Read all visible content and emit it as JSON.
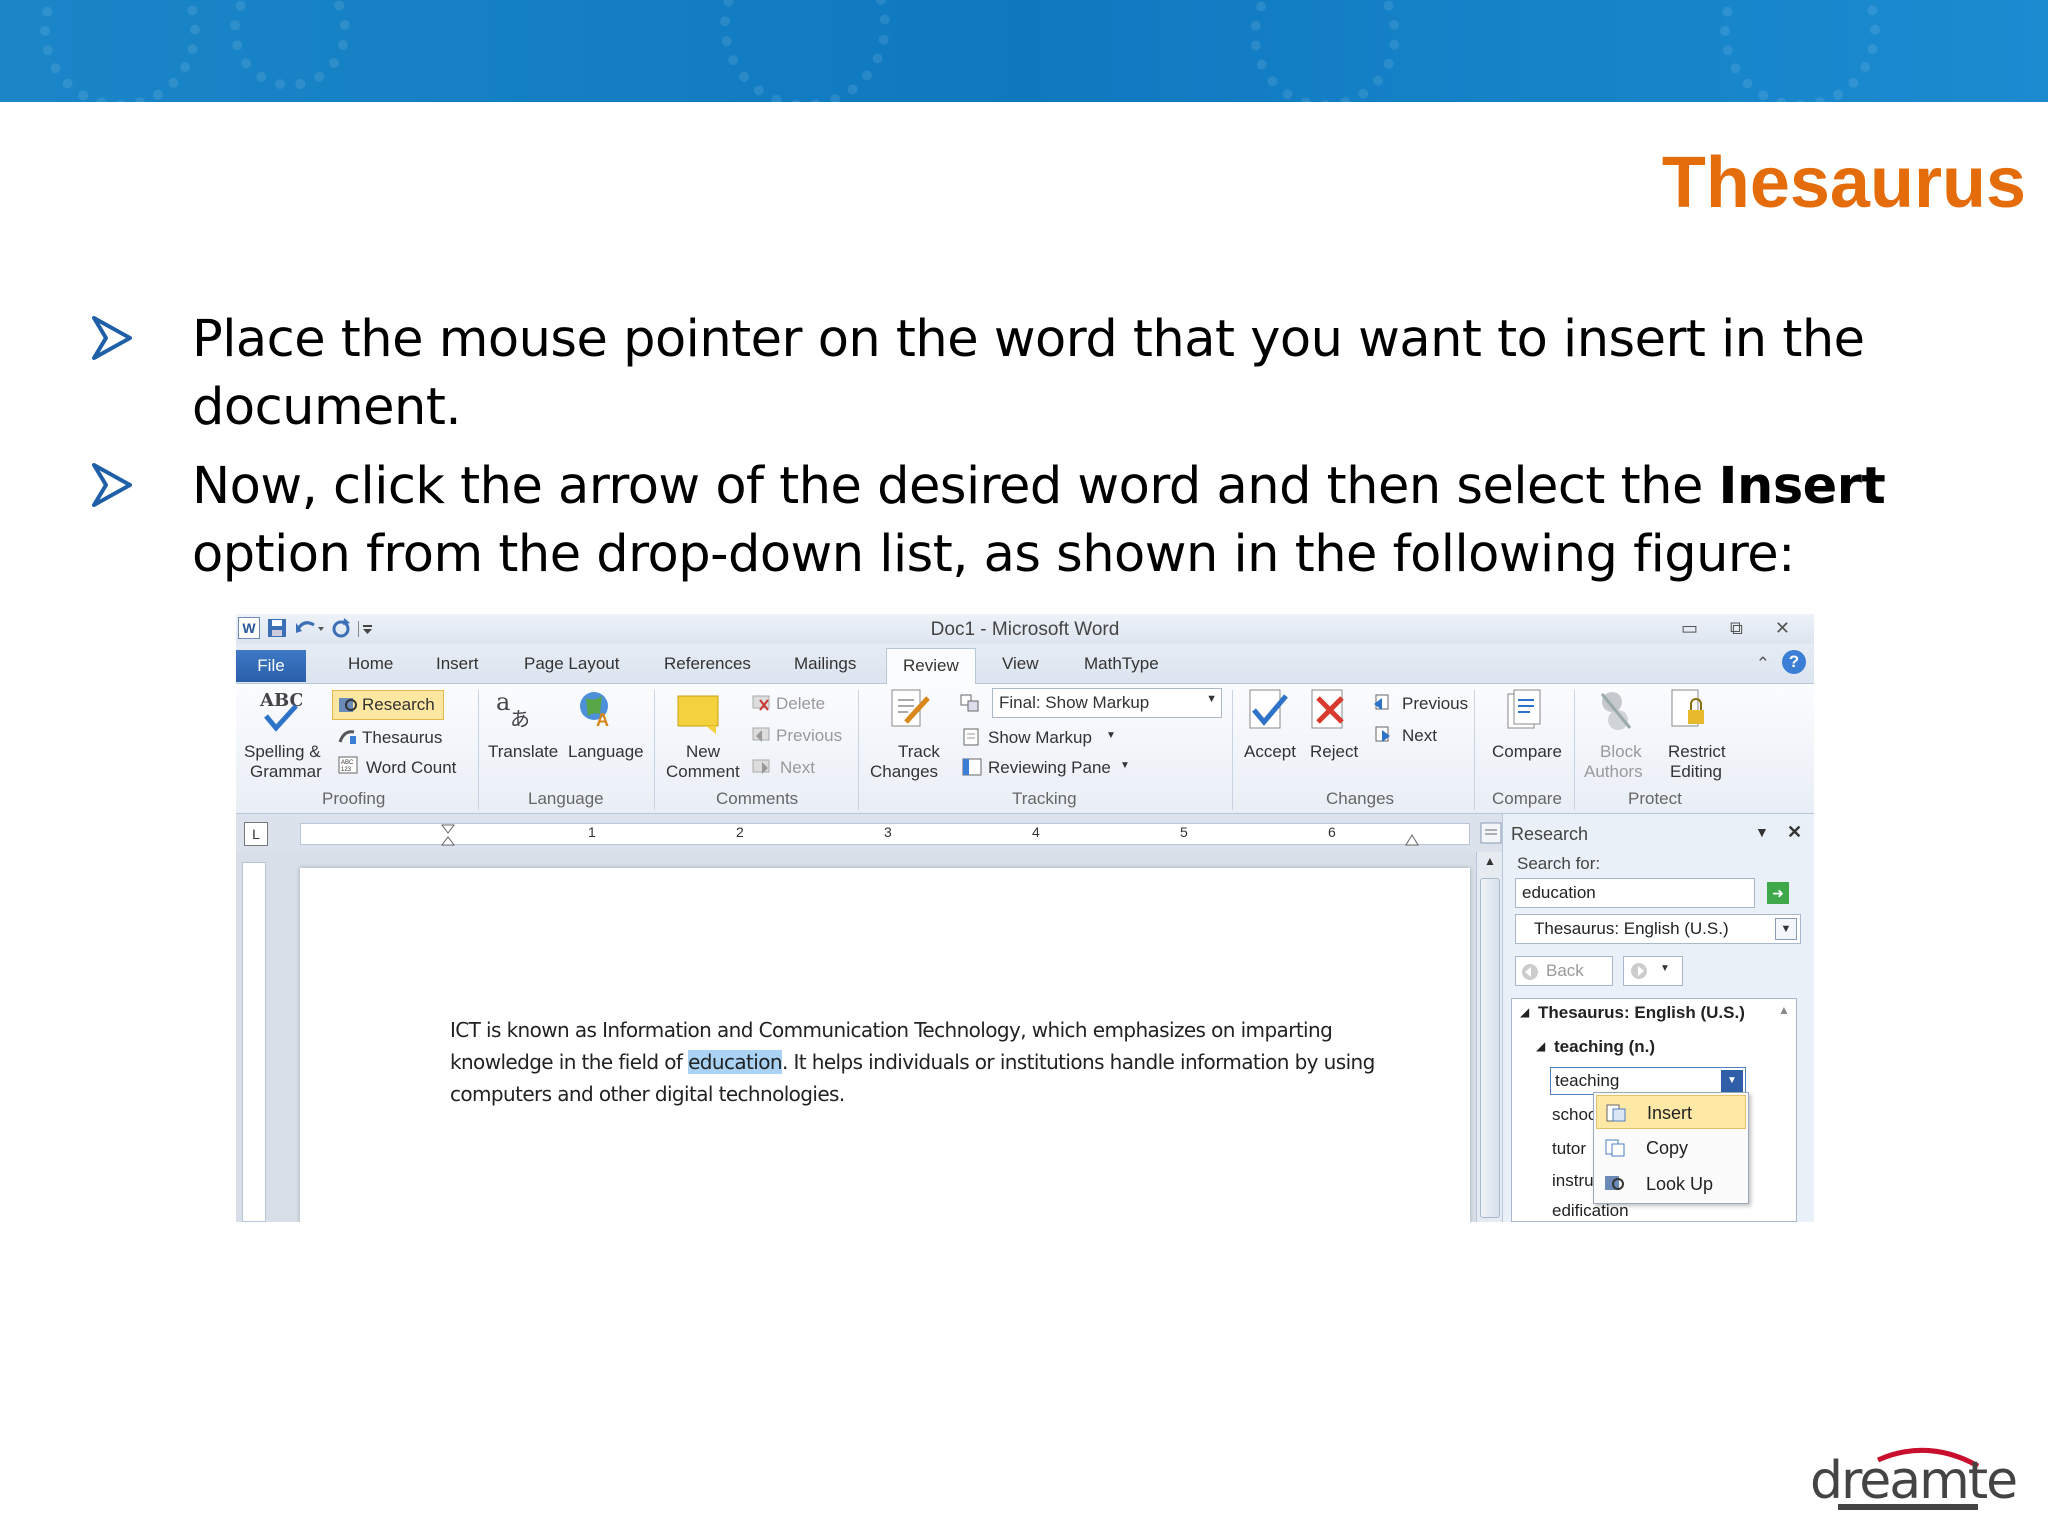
{
  "slide": {
    "title": "Thesaurus",
    "bullet1": "Place the mouse pointer on the word that you want to insert in the document.",
    "bullet2_pre": "Now, click the arrow of the desired word and then select the ",
    "bullet2_bold": "Insert",
    "bullet2_post": " option from the drop-down list, as shown in the following figure:",
    "logo_text": "dreamtech",
    "colors": {
      "title": "#e46c0a",
      "banner": "#1a86c8",
      "bullet_arrow": "#1f5fa8"
    }
  },
  "word": {
    "window_title": "Doc1  -  Microsoft Word",
    "tabs": [
      "File",
      "Home",
      "Insert",
      "Page Layout",
      "References",
      "Mailings",
      "Review",
      "View",
      "MathType"
    ],
    "active_tab": "Review",
    "proofing": {
      "spelling_line1": "Spelling &",
      "spelling_line2": "Grammar",
      "research": "Research",
      "thesaurus": "Thesaurus",
      "word_count": "Word Count",
      "group": "Proofing"
    },
    "language": {
      "translate": "Translate",
      "language": "Language",
      "group": "Language"
    },
    "comments": {
      "new_line1": "New",
      "new_line2": "Comment",
      "delete": "Delete",
      "previous": "Previous",
      "next": "Next",
      "group": "Comments"
    },
    "tracking": {
      "track_line1": "Track",
      "track_line2": "Changes",
      "final_show_markup": "Final: Show Markup",
      "show_markup": "Show Markup",
      "reviewing_pane": "Reviewing Pane",
      "group": "Tracking"
    },
    "changes": {
      "accept": "Accept",
      "reject": "Reject",
      "previous": "Previous",
      "next": "Next",
      "group": "Changes"
    },
    "compare": {
      "compare": "Compare",
      "group": "Compare"
    },
    "protect": {
      "block_line1": "Block",
      "block_line2": "Authors",
      "restrict_line1": "Restrict",
      "restrict_line2": "Editing",
      "group": "Protect"
    },
    "ruler_numbers": [
      "1",
      "2",
      "3",
      "4",
      "5",
      "6"
    ],
    "document": {
      "line1": "ICT is known as Information and Communication Technology, which emphasizes on imparting",
      "line2_pre": "knowledge in the field of ",
      "line2_selected": "education",
      "line2_post": ". It helps individuals or institutions handle information by using",
      "line3": "computers and other digital technologies."
    },
    "research_pane": {
      "title": "Research",
      "search_for_label": "Search for:",
      "search_value": "education",
      "source": "Thesaurus: English (U.S.)",
      "back": "Back",
      "results_header": "Thesaurus: English (U.S.)",
      "sense": "teaching (n.)",
      "selected_word": "teaching",
      "words": [
        "schoo",
        "tutor",
        "instru",
        "edification"
      ],
      "menu": [
        "Insert",
        "Copy",
        "Look Up"
      ]
    }
  }
}
